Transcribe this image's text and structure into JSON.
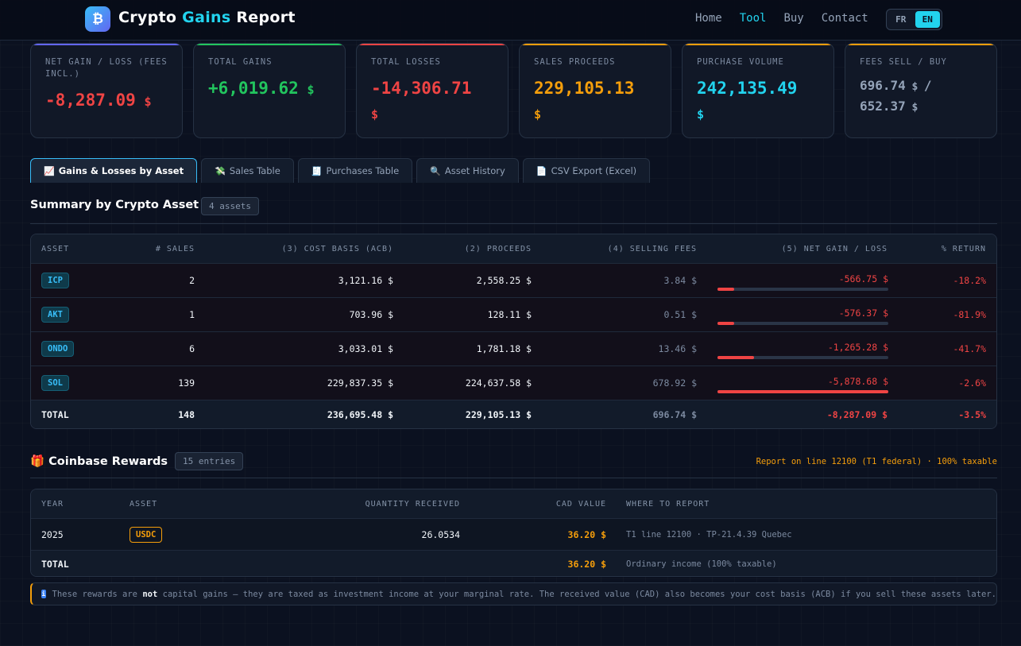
{
  "brand": {
    "logo_glyph": "₿",
    "title_part1": "Crypto",
    "title_accent": "Gains",
    "title_part2": "Report"
  },
  "nav": {
    "links": [
      "Home",
      "Tool",
      "Buy",
      "Contact"
    ],
    "active": "Tool",
    "lang": [
      "FR",
      "EN"
    ],
    "lang_active": "EN"
  },
  "stats": [
    {
      "label": "NET GAIN / LOSS (FEES INCL.)",
      "value": "-8,287.09",
      "currency": "$",
      "color": "#ef4444",
      "bar": "#6366f1"
    },
    {
      "label": "TOTAL GAINS",
      "value": "+6,019.62",
      "currency": "$",
      "color": "#22c55e",
      "bar": "#22c55e"
    },
    {
      "label": "TOTAL LOSSES",
      "value": "-14,306.71",
      "currency": "$",
      "color": "#ef4444",
      "bar": "#ef4444"
    },
    {
      "label": "SALES PROCEEDS",
      "value": "229,105.13",
      "currency": "$",
      "color": "#f59e0b",
      "bar": "#f59e0b"
    },
    {
      "label": "PURCHASE VOLUME",
      "value": "242,135.49",
      "currency": "$",
      "color": "#22d3ee",
      "bar": "#f59e0b"
    },
    {
      "label": "FEES SELL / BUY",
      "value": "696.74",
      "currency": "$",
      "value2": "652.37",
      "currency2": "$",
      "sep": "/",
      "color": "#94a3b8",
      "bar": "#f59e0b"
    }
  ],
  "tabs": [
    {
      "icon": "📈",
      "label": "Gains & Losses by Asset"
    },
    {
      "icon": "💸",
      "label": "Sales Table"
    },
    {
      "icon": "🧾",
      "label": "Purchases Table"
    },
    {
      "icon": "🔍",
      "label": "Asset History"
    },
    {
      "icon": "📄",
      "label": "CSV Export (Excel)"
    }
  ],
  "summary": {
    "title": "Summary by Crypto Asset",
    "count": "4 assets",
    "headers": [
      "ASSET",
      "# SALES",
      "(3) COST BASIS (ACB)",
      "(2) PROCEEDS",
      "(4) SELLING FEES",
      "(5) NET GAIN / LOSS",
      "% RETURN"
    ],
    "rows": [
      {
        "asset": "ICP",
        "sales": "2",
        "acb": "3,121.16 $",
        "proceeds": "2,558.25 $",
        "fees": "3.84 $",
        "net": "-566.75 $",
        "net_share": 0.096,
        "ret": "-18.2%"
      },
      {
        "asset": "AKT",
        "sales": "1",
        "acb": "703.96 $",
        "proceeds": "128.11 $",
        "fees": "0.51 $",
        "net": "-576.37 $",
        "net_share": 0.098,
        "ret": "-81.9%"
      },
      {
        "asset": "ONDO",
        "sales": "6",
        "acb": "3,033.01 $",
        "proceeds": "1,781.18 $",
        "fees": "13.46 $",
        "net": "-1,265.28 $",
        "net_share": 0.215,
        "ret": "-41.7%"
      },
      {
        "asset": "SOL",
        "sales": "139",
        "acb": "229,837.35 $",
        "proceeds": "224,637.58 $",
        "fees": "678.92 $",
        "net": "-5,878.68 $",
        "net_share": 1.0,
        "ret": "-2.6%"
      }
    ],
    "total": {
      "label": "TOTAL",
      "sales": "148",
      "acb": "236,695.48 $",
      "proceeds": "229,105.13 $",
      "fees": "696.74 $",
      "net": "-8,287.09 $",
      "ret": "-3.5%"
    }
  },
  "rewards": {
    "icon": "🎁",
    "title": "Coinbase Rewards",
    "count": "15 entries",
    "note": "Report on line 12100 (T1 federal) · 100% taxable",
    "headers": [
      "YEAR",
      "ASSET",
      "QUANTITY RECEIVED",
      "CAD VALUE",
      "WHERE TO REPORT"
    ],
    "rows": [
      {
        "year": "2025",
        "asset": "USDC",
        "qty": "26.0534",
        "cad": "36.20 $",
        "where": "T1 line 12100 · TP-21.4.39 Quebec"
      }
    ],
    "total": {
      "label": "TOTAL",
      "cad": "36.20 $",
      "where": "Ordinary income (100% taxable)"
    }
  },
  "notice": {
    "icon": "i",
    "pre": "These rewards are ",
    "bold": "not",
    "post": " capital gains — they are taxed as investment income at your marginal rate. The received value (CAD) also becomes your cost basis (ACB) if you sell these assets later."
  }
}
